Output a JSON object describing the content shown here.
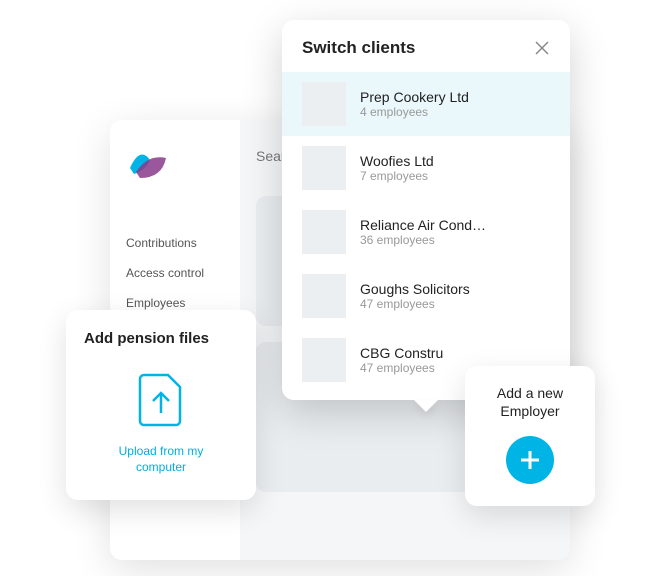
{
  "sidebar": {
    "items": [
      {
        "label": "Contributions"
      },
      {
        "label": "Access control"
      },
      {
        "label": "Employees"
      }
    ]
  },
  "search": {
    "placeholder": "Search"
  },
  "switch_clients": {
    "title": "Switch clients",
    "items": [
      {
        "name": "Prep Cookery Ltd",
        "sub": "4 employees"
      },
      {
        "name": "Woofies Ltd",
        "sub": "7 employees"
      },
      {
        "name": "Reliance Air Cond…",
        "sub": "36 employees"
      },
      {
        "name": "Goughs Solicitors",
        "sub": "47 employees"
      },
      {
        "name": "CBG Constru",
        "sub": "47 employees"
      }
    ]
  },
  "pension_files": {
    "title": "Add pension files",
    "upload_label": "Upload from my computer"
  },
  "add_employer": {
    "title": "Add a new Employer"
  },
  "colors": {
    "accent": "#00b5e6"
  }
}
